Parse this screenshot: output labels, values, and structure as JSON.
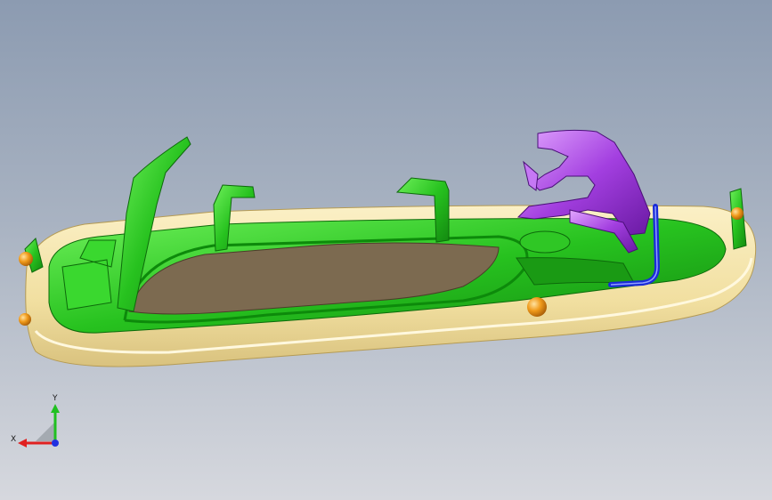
{
  "view": {
    "background_top": "#8c9bb1",
    "background_bottom": "#d6d8de"
  },
  "model": {
    "tray_color": "#f3e2a8",
    "cavity_color": "#7c6a50",
    "frame_color": "#22c11e",
    "bracket_color": "#a33fe0",
    "tube_color": "#1a2bd8",
    "sphere_color": "#f09a1a"
  },
  "triad": {
    "x_label": "X",
    "y_label": "Y",
    "x_color": "#e02020",
    "y_color": "#20c020",
    "z_color": "#2030e0"
  }
}
